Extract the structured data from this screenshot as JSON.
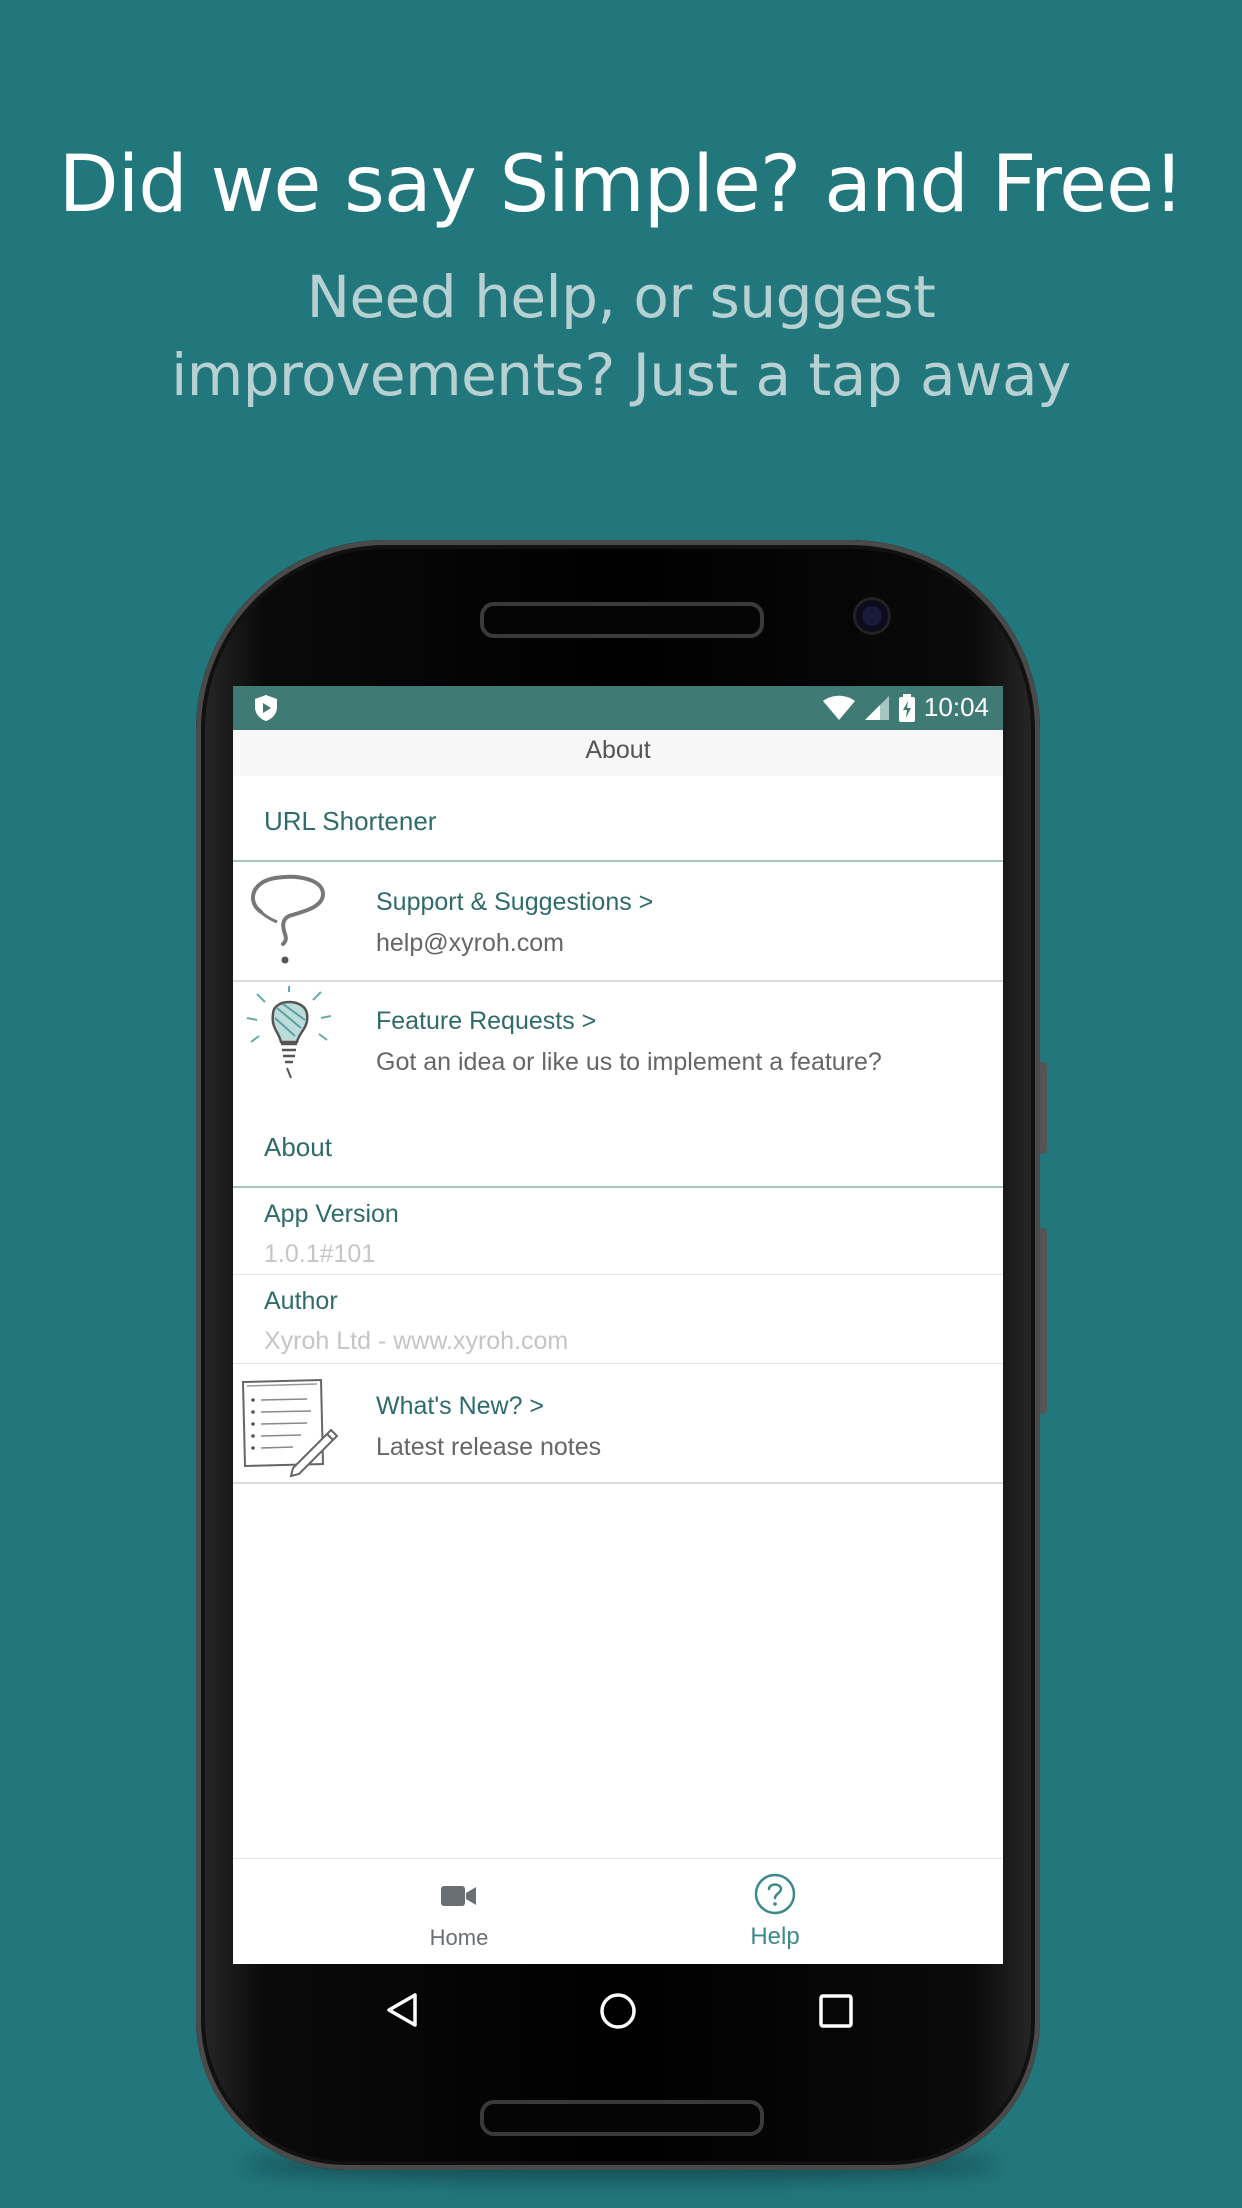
{
  "promo": {
    "headline": "Did we say Simple? and Free!",
    "subline": "Need help, or suggest improvements? Just a tap away"
  },
  "status_bar": {
    "time": "10:04"
  },
  "app_bar": {
    "title": "About"
  },
  "sections": {
    "url_shortener": "URL Shortener",
    "about": "About"
  },
  "support": {
    "title": "Support & Suggestions >",
    "subtitle": "help@xyroh.com",
    "icon": "question-mark-sketch-icon"
  },
  "feature_requests": {
    "title": "Feature Requests >",
    "subtitle": "Got an idea or like us to implement a feature?",
    "icon": "lightbulb-sketch-icon"
  },
  "app_version": {
    "title": "App Version",
    "value": "1.0.1#101"
  },
  "author": {
    "title": "Author",
    "value": "Xyroh Ltd - www.xyroh.com"
  },
  "whats_new": {
    "title": "What's New? >",
    "subtitle": "Latest release notes",
    "icon": "notepad-sketch-icon"
  },
  "bottom_nav": {
    "home_label": "Home",
    "help_label": "Help",
    "active": "Help"
  },
  "colors": {
    "background": "#22777d",
    "status_bar": "#3f7a75",
    "accent_text": "#2f6b6b",
    "help_active": "#3d8a8a"
  }
}
